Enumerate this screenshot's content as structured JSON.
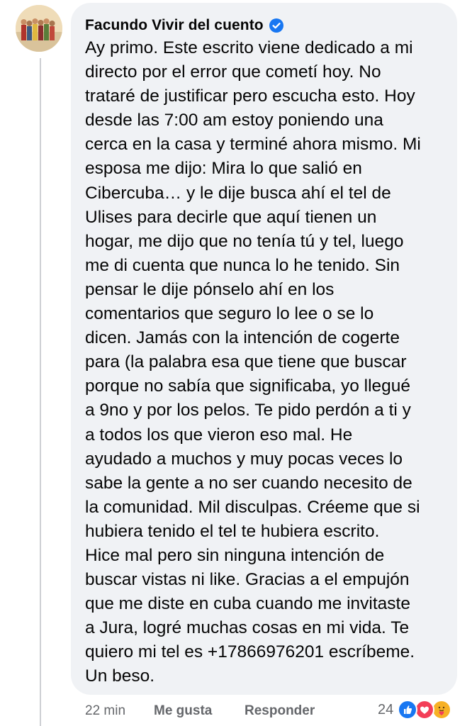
{
  "comment": {
    "author": "Facundo Vivir del cuento",
    "author_verified": true,
    "body_lines": [
      "Ay primo. Este escrito viene dedicado a mi",
      "directo por el error que cometí hoy. No",
      "trataré de justificar pero escucha esto. Hoy",
      "desde las 7:00 am estoy poniendo una",
      "cerca en la casa y terminé ahora mismo. Mi",
      "esposa me dijo: Mira lo que salió en",
      "Cibercuba… y le dije busca ahí el tel de",
      "Ulises para decirle que aquí tienen un",
      "hogar, me dijo que no tenía tú y tel, luego",
      "me di cuenta que nunca lo he tenido. Sin",
      "pensar le dije pónselo ahí en los",
      "comentarios que seguro lo lee o se lo",
      "dicen. Jamás con la intención de cogerte",
      "para (la palabra esa que tiene que buscar",
      "porque no sabía que significaba, yo llegué",
      "a 9no y por los pelos. Te pido perdón a ti y",
      "a todos los que vieron eso mal. He",
      "ayudado a muchos y muy pocas veces lo",
      "sabe la gente a no ser cuando necesito de",
      "la comunidad. Mil disculpas. Créeme que si",
      "hubiera tenido el tel te hubiera escrito.",
      "Hice mal pero sin ninguna intención de",
      "buscar vistas ni like. Gracias a el empujón",
      "que me diste en cuba cuando me invitaste",
      "a Jura, logré muchas cosas en mi vida. Te",
      "quiero mi tel es +17866976201 escríbeme.",
      "Un beso."
    ]
  },
  "footer": {
    "timestamp": "22 min",
    "like_label": "Me gusta",
    "reply_label": "Responder",
    "reaction_count": "24",
    "reaction_icons": [
      "like-icon",
      "love-icon",
      "care-icon"
    ]
  },
  "colors": {
    "bubble_bg": "#f0f2f5",
    "text": "#050505",
    "secondary_text": "#65676b",
    "verified_blue": "#1877f2",
    "like_blue": "#1877f2",
    "love_red": "#f33e58",
    "care_yellow": "#f7b125"
  }
}
